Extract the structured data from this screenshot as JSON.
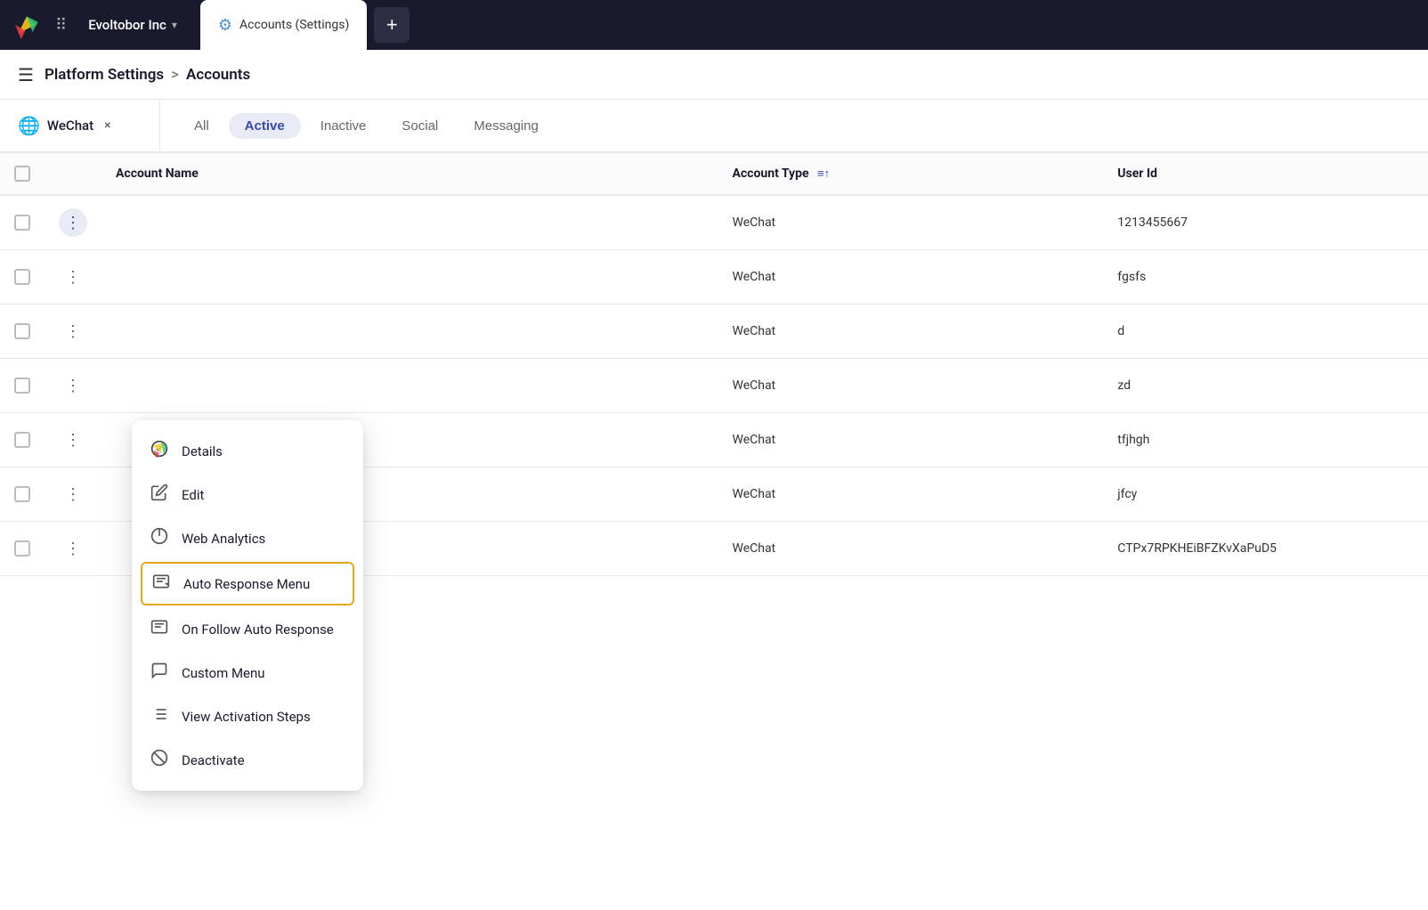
{
  "topbar": {
    "logo_alt": "Evoltobor logo",
    "company_name": "Evoltobor Inc",
    "tab_title": "Accounts (Settings)",
    "new_tab_label": "+"
  },
  "breadcrumb": {
    "hamburger": "☰",
    "parent": "Platform Settings",
    "separator": ">",
    "current": "Accounts"
  },
  "filter": {
    "chip_icon": "🌐",
    "chip_label": "WeChat",
    "chip_close": "×",
    "tabs": [
      "All",
      "Active",
      "Inactive",
      "Social",
      "Messaging"
    ],
    "active_tab": "Active"
  },
  "table": {
    "columns": [
      "",
      "",
      "Account Name",
      "Account Type",
      "User Id"
    ],
    "account_type_sort": "≡↑",
    "rows": [
      {
        "account_name": "",
        "account_type": "WeChat",
        "user_id": "1213455667",
        "menu_active": true
      },
      {
        "account_name": "",
        "account_type": "WeChat",
        "user_id": "fgsfs",
        "menu_active": false
      },
      {
        "account_name": "",
        "account_type": "WeChat",
        "user_id": "d",
        "menu_active": false
      },
      {
        "account_name": "",
        "account_type": "WeChat",
        "user_id": "zd",
        "menu_active": false
      },
      {
        "account_name": "",
        "account_type": "WeChat",
        "user_id": "tfjhgh",
        "menu_active": false
      },
      {
        "account_name": "",
        "account_type": "WeChat",
        "user_id": "jfcy",
        "menu_active": false
      },
      {
        "account_name": "",
        "account_type": "WeChat",
        "user_id": "CTPx7RPKHEiBFZKvXaPuD5",
        "menu_active": false
      }
    ]
  },
  "dropdown": {
    "items": [
      {
        "id": "details",
        "label": "Details",
        "icon": "details"
      },
      {
        "id": "edit",
        "label": "Edit",
        "icon": "edit"
      },
      {
        "id": "web-analytics",
        "label": "Web Analytics",
        "icon": "analytics"
      },
      {
        "id": "auto-response-menu",
        "label": "Auto Response Menu",
        "icon": "auto-response",
        "highlighted": true
      },
      {
        "id": "on-follow",
        "label": "On Follow Auto Response",
        "icon": "follow"
      },
      {
        "id": "custom-menu",
        "label": "Custom Menu",
        "icon": "chat"
      },
      {
        "id": "view-activation",
        "label": "View Activation Steps",
        "icon": "list"
      },
      {
        "id": "deactivate",
        "label": "Deactivate",
        "icon": "block"
      }
    ]
  }
}
